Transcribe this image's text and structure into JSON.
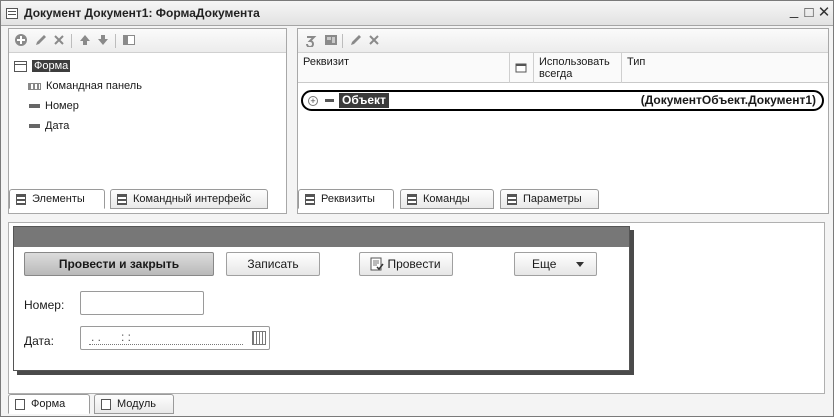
{
  "window": {
    "title": "Документ Документ1: ФормаДокумента",
    "controls": [
      "_",
      "□",
      "✕"
    ]
  },
  "left_panel": {
    "toolbar": [
      "add-icon",
      "edit-icon",
      "delete-icon",
      "move-up-icon",
      "move-down-icon",
      "panel-icon"
    ],
    "tree": [
      {
        "label": "Форма",
        "icon": "form-icon",
        "selected": true
      },
      {
        "label": "Командная панель",
        "icon": "command-bar-icon"
      },
      {
        "label": "Номер",
        "icon": "field-icon"
      },
      {
        "label": "Дата",
        "icon": "field-icon"
      }
    ],
    "tabs": [
      {
        "label": "Элементы",
        "active": true
      },
      {
        "label": "Командный интерфейс"
      }
    ]
  },
  "right_panel": {
    "toolbar": [
      "add-requisite-icon",
      "table-icon",
      "edit-icon",
      "delete-icon"
    ],
    "columns": {
      "requisite": "Реквизит",
      "use_always": "Использовать всегда",
      "type": "Тип"
    },
    "row": {
      "name": "Объект",
      "type": "(ДокументОбъект.Документ1)"
    },
    "tabs": [
      {
        "label": "Реквизиты",
        "active": true
      },
      {
        "label": "Команды"
      },
      {
        "label": "Параметры"
      }
    ]
  },
  "form_preview": {
    "buttons": {
      "post_close": "Провести и закрыть",
      "save": "Записать",
      "post": "Провести",
      "more": "Еще"
    },
    "fields": {
      "number_label": "Номер:",
      "number_value": "",
      "date_label": "Дата:",
      "date_value": ". .      : :"
    }
  },
  "bottom_tabs": [
    {
      "label": "Форма",
      "active": true
    },
    {
      "label": "Модуль"
    }
  ]
}
